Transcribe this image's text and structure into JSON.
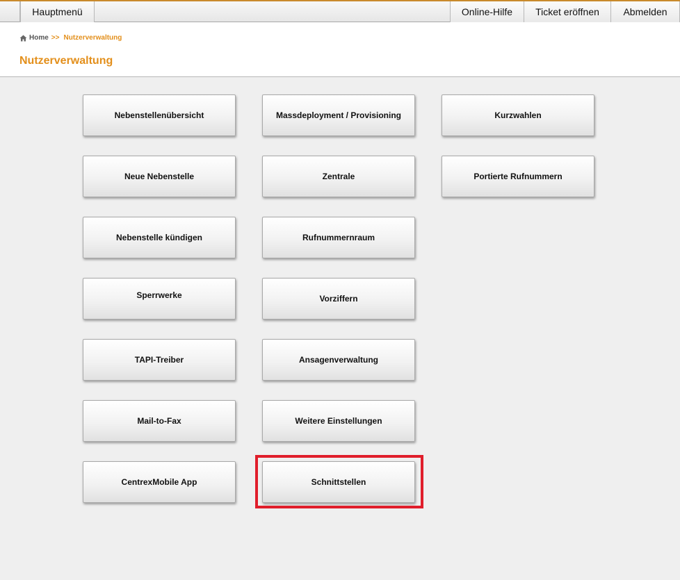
{
  "topbar": {
    "main_menu": "Hauptmenü",
    "online_help": "Online-Hilfe",
    "open_ticket": "Ticket eröffnen",
    "logout": "Abmelden"
  },
  "breadcrumb": {
    "home": "Home",
    "separator": ">>",
    "current": "Nutzerverwaltung"
  },
  "page_title": "Nutzerverwaltung",
  "tiles": {
    "col1": [
      "Nebenstellenübersicht",
      "Neue Nebenstelle",
      "Nebenstelle kündigen",
      "Sperrwerke",
      "TAPI-Treiber",
      "Mail-to-Fax",
      "CentrexMobile App"
    ],
    "col2": [
      "Massdeployment / Provisioning",
      "Zentrale",
      "Rufnummernraum",
      "Vorziffern",
      "Ansagenverwaltung",
      "Weitere Einstellungen",
      "Schnittstellen"
    ],
    "col3": [
      "Kurzwahlen",
      "Portierte Rufnummern"
    ]
  },
  "colors": {
    "accent": "#e38f1b",
    "highlight": "#e01e2b"
  },
  "icons": {
    "home": "home-icon"
  }
}
